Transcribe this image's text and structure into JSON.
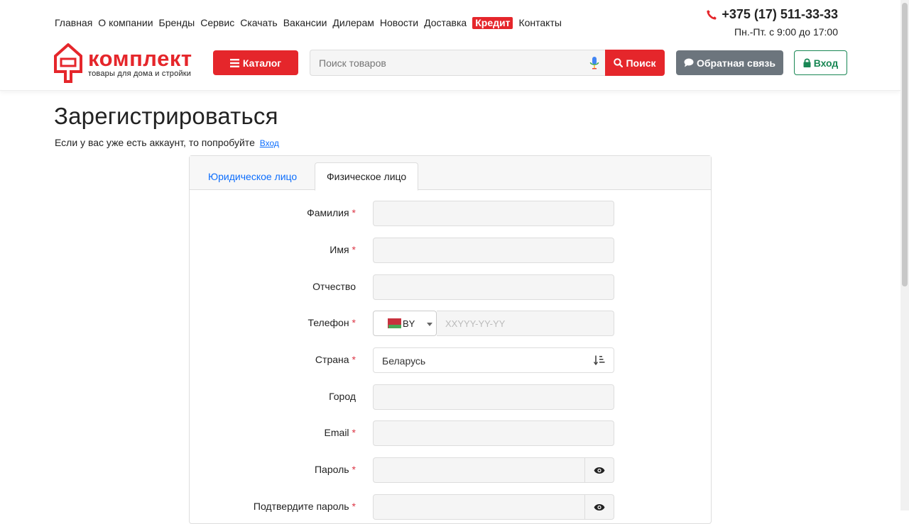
{
  "nav": {
    "links": [
      "Главная",
      "О компании",
      "Бренды",
      "Сервис",
      "Скачать",
      "Вакансии",
      "Дилерам",
      "Новости",
      "Доставка"
    ],
    "credit": "Кредит",
    "contacts": "Контакты"
  },
  "contact": {
    "phone": "+375 (17) 511-33-33",
    "hours": "Пн.-Пт. с 9:00 до 17:00"
  },
  "logo": {
    "name": "комплект",
    "tagline": "товары для дома и стройки"
  },
  "toolbar": {
    "catalog": "Каталог",
    "search_placeholder": "Поиск товаров",
    "search_button": "Поиск",
    "feedback": "Обратная связь",
    "login": "Вход"
  },
  "page": {
    "title": "Зарегистрироваться",
    "subtitle": "Если у вас уже есть аккаунт, то попробуйте",
    "subtitle_link": "Вход"
  },
  "tabs": {
    "legal": "Юридическое лицо",
    "individual": "Физическое лицо"
  },
  "form": {
    "surname": "Фамилия",
    "name": "Имя",
    "patronymic": "Отчество",
    "phone": "Телефон",
    "phone_country": "BY",
    "phone_placeholder": "XXYYY-YY-YY",
    "country": "Страна",
    "country_value": "Беларусь",
    "city": "Город",
    "email": "Email",
    "password": "Пароль",
    "confirm_password": "Подтвердите пароль",
    "required_mark": "*"
  },
  "colors": {
    "brand": "#e5262b",
    "link": "#0d6efd",
    "login": "#198754",
    "feedback": "#6c757d"
  }
}
